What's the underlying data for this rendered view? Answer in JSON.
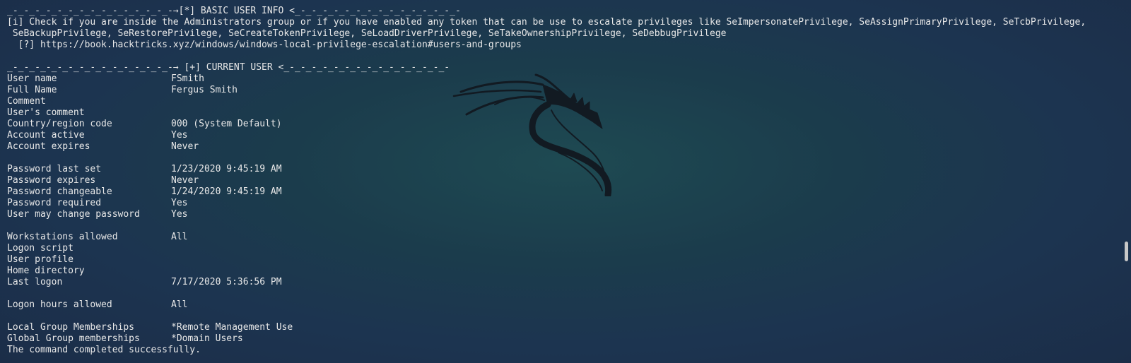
{
  "terminal": {
    "basic_header": "_-_-_-_-_-_-_-_-_-_-_-_-_-_-_-→[*] BASIC USER INFO <_-_-_-_-_-_-_-_-_-_-_-_-_-_-_-",
    "info_line_1": "[i] Check if you are inside the Administrators group or if you have enabled any token that can be use to escalate privileges like SeImpersonatePrivilege, SeAssignPrimaryPrivilege, SeTcbPrivilege,",
    "info_line_2": " SeBackupPrivilege, SeRestorePrivilege, SeCreateTokenPrivilege, SeLoadDriverPrivilege, SeTakeOwnershipPrivilege, SeDebbugPrivilege",
    "link_line": "  [?] https://book.hacktricks.xyz/windows/windows-local-privilege-escalation#users-and-groups",
    "current_header": "_-_-_-_-_-_-_-_-_-_-_-_-_-_-_-→ [+] CURRENT USER <_-_-_-_-_-_-_-_-_-_-_-_-_-_-_-",
    "fields": {
      "user_name": {
        "k": "User name",
        "v": "FSmith"
      },
      "full_name": {
        "k": "Full Name",
        "v": "Fergus Smith"
      },
      "comment": {
        "k": "Comment",
        "v": ""
      },
      "users_comment": {
        "k": "User's comment",
        "v": ""
      },
      "country": {
        "k": "Country/region code",
        "v": "000 (System Default)"
      },
      "account_active": {
        "k": "Account active",
        "v": "Yes"
      },
      "account_expires": {
        "k": "Account expires",
        "v": "Never"
      },
      "pw_last_set": {
        "k": "Password last set",
        "v": "1/23/2020 9:45:19 AM"
      },
      "pw_expires": {
        "k": "Password expires",
        "v": "Never"
      },
      "pw_changeable": {
        "k": "Password changeable",
        "v": "1/24/2020 9:45:19 AM"
      },
      "pw_required": {
        "k": "Password required",
        "v": "Yes"
      },
      "user_may_change": {
        "k": "User may change password",
        "v": "Yes"
      },
      "workstations": {
        "k": "Workstations allowed",
        "v": "All"
      },
      "logon_script": {
        "k": "Logon script",
        "v": ""
      },
      "user_profile": {
        "k": "User profile",
        "v": ""
      },
      "home_dir": {
        "k": "Home directory",
        "v": ""
      },
      "last_logon": {
        "k": "Last logon",
        "v": "7/17/2020 5:36:56 PM"
      },
      "logon_hours": {
        "k": "Logon hours allowed",
        "v": "All"
      },
      "local_groups": {
        "k": "Local Group Memberships",
        "v": "*Remote Management Use"
      },
      "global_groups": {
        "k": "Global Group memberships",
        "v": "*Domain Users"
      }
    },
    "completed": "The command completed successfully."
  },
  "colors": {
    "text": "#e8e8e8",
    "background": "#1c3a4c",
    "logo": "#121a22"
  },
  "icons": {
    "logo": "kali-dragon-icon"
  }
}
